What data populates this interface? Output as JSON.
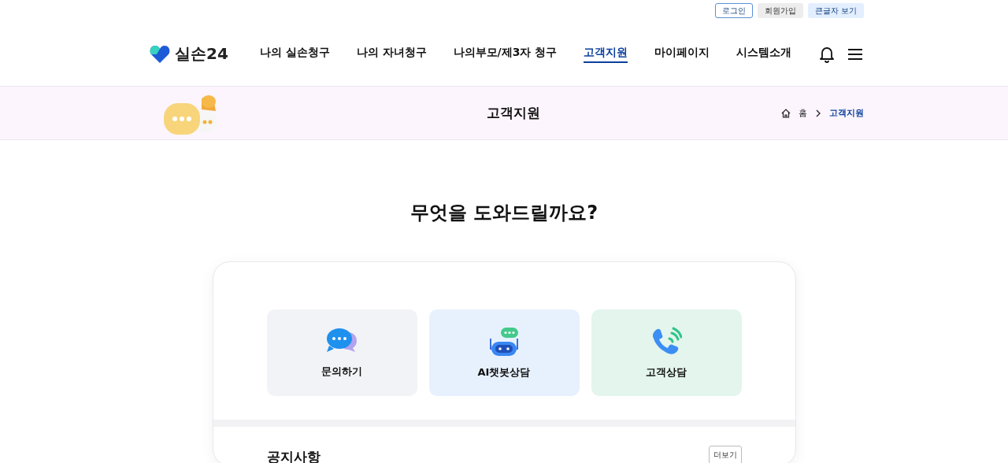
{
  "utility_links": [
    {
      "label": "로그인",
      "kind": "outline"
    },
    {
      "label": "회원가입",
      "kind": "grey"
    },
    {
      "label": "큰글자 보기",
      "kind": "blue"
    }
  ],
  "logo": {
    "text": "실손24"
  },
  "nav": [
    {
      "label": "나의 실손청구",
      "selected": false
    },
    {
      "label": "나의 자녀청구",
      "selected": false
    },
    {
      "label": "나의부모/제3자 청구",
      "selected": false
    },
    {
      "label": "고객지원",
      "selected": true
    },
    {
      "label": "마이페이지",
      "selected": false
    },
    {
      "label": "시스템소개",
      "selected": false
    }
  ],
  "banner": {
    "title": "고객지원",
    "breadcrumb": [
      {
        "label": "홈",
        "kind": "home"
      },
      {
        "label": "고객지원",
        "kind": "current"
      }
    ]
  },
  "heading": "무엇을 도와드릴까요?",
  "services": [
    {
      "label": "문의하기",
      "kind": "chat",
      "color": "#f2f3f6"
    },
    {
      "label": "AI챗봇상담",
      "kind": "bot",
      "color": "#e7f1fd"
    },
    {
      "label": "고객상담",
      "kind": "phone",
      "color": "#e3f5ec"
    }
  ],
  "notice": {
    "title": "공지사항",
    "more": "더보기"
  }
}
